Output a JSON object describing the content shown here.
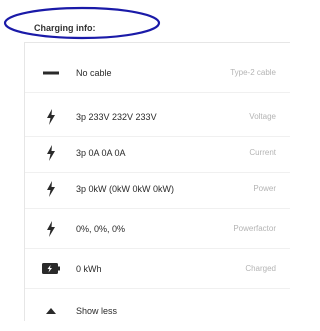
{
  "header": {
    "title": "Charging info:"
  },
  "rows": [
    {
      "icon": "dash-icon",
      "value": "No cable",
      "label": "Type-2 cable"
    },
    {
      "icon": "lightning-icon",
      "value": "3p 233V 232V 233V",
      "label": "Voltage"
    },
    {
      "icon": "lightning-icon",
      "value": "3p 0A 0A 0A",
      "label": "Current"
    },
    {
      "icon": "lightning-icon",
      "value": "3p 0kW (0kW 0kW 0kW)",
      "label": "Power"
    },
    {
      "icon": "lightning-icon",
      "value": "0%, 0%, 0%",
      "label": "Powerfactor"
    },
    {
      "icon": "battery-icon",
      "value": "0 kWh",
      "label": "Charged"
    }
  ],
  "toggle": {
    "icon": "triangle-up-icon",
    "label": "Show less"
  },
  "colors": {
    "highlight_ellipse": "#1a1aa8",
    "text": "#2a2a2a",
    "muted_label": "#b4b4b4"
  }
}
